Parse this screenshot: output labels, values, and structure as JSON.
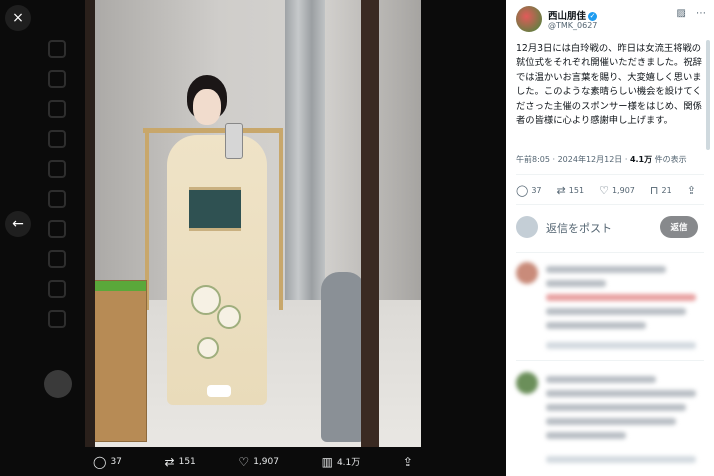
{
  "viewer": {
    "close_icon": "×",
    "back_icon": "←",
    "collapse_icon": "»"
  },
  "photo_actions": {
    "replies": "37",
    "reposts": "151",
    "likes": "1,907",
    "views": "4.1万"
  },
  "tweet": {
    "author_name": "西山朋佳",
    "handle": "@TMK_0627",
    "text": "12月3日には白玲戦の、昨日は女流王将戦の就位式をそれぞれ開催いただきました。祝辞では温かいお言葉を賜り、大変嬉しく思いました。このような素晴らしい機会を設けてくださった主催のスポンサー様をはじめ、関係者の皆様に心より感謝申し上げます。",
    "time": "午前8:05 · 2024年12月12日 · ",
    "views_count": "4.1万",
    "views_label": " 件の表示",
    "stats": {
      "replies": "37",
      "reposts": "151",
      "likes": "1,907",
      "bookmarks": "21"
    }
  },
  "reply_box": {
    "placeholder": "返信をポスト",
    "button": "返信"
  },
  "colors": {
    "accent": "#1d9bf0",
    "reply_button": "#87898c"
  }
}
